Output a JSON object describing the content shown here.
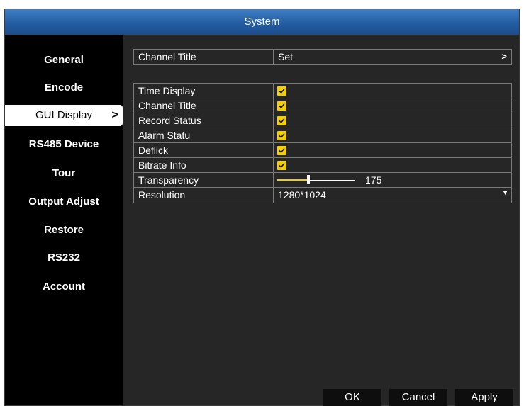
{
  "window": {
    "title": "System"
  },
  "sidebar": {
    "items": [
      {
        "label": "General",
        "active": false
      },
      {
        "label": "Encode",
        "active": false
      },
      {
        "label": "GUI Display",
        "active": true
      },
      {
        "label": "RS485 Device",
        "active": false
      },
      {
        "label": "Tour",
        "active": false
      },
      {
        "label": "Output Adjust",
        "active": false
      },
      {
        "label": "Restore",
        "active": false
      },
      {
        "label": "RS232",
        "active": false
      },
      {
        "label": "Account",
        "active": false
      }
    ],
    "active_chevron": ">"
  },
  "channel_title_row": {
    "label": "Channel Title",
    "value": "Set",
    "arrow": ">"
  },
  "settings": {
    "time_display": {
      "label": "Time Display",
      "checked": true
    },
    "channel_title": {
      "label": "Channel Title",
      "checked": true
    },
    "record_status": {
      "label": "Record Status",
      "checked": true
    },
    "alarm_statu": {
      "label": "Alarm Statu",
      "checked": true
    },
    "deflick": {
      "label": "Deflick",
      "checked": true
    },
    "bitrate_info": {
      "label": "Bitrate Info",
      "checked": true
    },
    "transparency": {
      "label": "Transparency",
      "value": "175",
      "min": 0,
      "max": 255
    },
    "resolution": {
      "label": "Resolution",
      "value": "1280*1024"
    }
  },
  "buttons": {
    "ok": "OK",
    "cancel": "Cancel",
    "apply": "Apply"
  },
  "colors": {
    "titlebar": "#245da2",
    "checkbox": "#f5d000",
    "panel": "#262626",
    "background": "#000000"
  },
  "icons": {
    "check": "check-icon",
    "chevron_right": "chevron-right-icon",
    "caret_down": "caret-down-icon"
  }
}
